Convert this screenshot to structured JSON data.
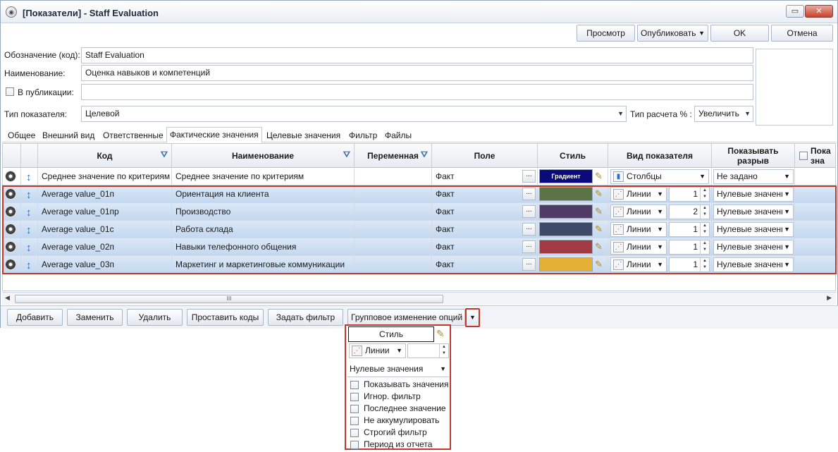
{
  "window": {
    "title": "[Показатели] - Staff Evaluation",
    "restore_glyph": "▭",
    "close_glyph": "✕"
  },
  "toolbar": {
    "preview": "Просмотр",
    "publish": "Опубликовать",
    "ok": "OK",
    "cancel": "Отмена"
  },
  "form": {
    "code_label": "Обозначение (код):",
    "code_value": "Staff Evaluation",
    "name_label": "Наименование:",
    "name_value": "Оценка навыков и компетенций",
    "publication_label": "В публикации:",
    "publication_value": "",
    "type_label": "Тип показателя:",
    "type_value": "Целевой",
    "calc_label": "Тип расчета % :",
    "calc_value": "Увеличить"
  },
  "tabs": [
    "Общее",
    "Внешний вид",
    "Ответственные",
    "Фактические значения",
    "Целевые значения",
    "Фильтр",
    "Файлы"
  ],
  "grid": {
    "headers": {
      "code": "Код",
      "name": "Наименование",
      "variable": "Переменная",
      "field": "Поле",
      "style": "Стиль",
      "view": "Вид показателя",
      "gap": "Показывать разрыв",
      "last": "Пока\nзна"
    },
    "first_row": {
      "code": "Среднее значение по критериям",
      "name": "Среднее значение по критериям",
      "field": "Факт",
      "style_label": "Градиент",
      "view": "Столбцы",
      "gap": "Не задано"
    },
    "rows": [
      {
        "code": "Average value_01п",
        "name": "Ориентация на клиента",
        "field": "Факт",
        "color": "#5b7347",
        "view": "Линии",
        "num": "1",
        "gap": "Нулевые значения"
      },
      {
        "code": "Average value_01пр",
        "name": "Производство",
        "field": "Факт",
        "color": "#4f3b66",
        "view": "Линии",
        "num": "2",
        "gap": "Нулевые значения"
      },
      {
        "code": "Average value_01с",
        "name": "Работа склада",
        "field": "Факт",
        "color": "#3e4b68",
        "view": "Линии",
        "num": "1",
        "gap": "Нулевые значения"
      },
      {
        "code": "Average value_02п",
        "name": "Навыки телефонного общения",
        "field": "Факт",
        "color": "#a23a44",
        "view": "Линии",
        "num": "1",
        "gap": "Нулевые значения"
      },
      {
        "code": "Average value_03п",
        "name": "Маркетинг и маркетинговые коммуникации",
        "field": "Факт",
        "color": "#e3b033",
        "view": "Линии",
        "num": "1",
        "gap": "Нулевые значения"
      }
    ],
    "dots": "...",
    "scroll_thumb": "III"
  },
  "bottom": {
    "add": "Добавить",
    "replace": "Заменить",
    "delete": "Удалить",
    "set_codes": "Проставить коды",
    "set_filter": "Задать фильтр",
    "group_change": "Групповое изменение опций"
  },
  "popup": {
    "style": "Стиль",
    "view": "Линии",
    "gap": "Нулевые значения",
    "options": [
      "Показывать значения",
      "Игнор. фильтр",
      "Последнее значение",
      "Не аккумулировать",
      "Строгий фильтр",
      "Период из отчета"
    ]
  },
  "colors": {
    "accent_outline": "#c0392b",
    "selected_row": "#c9dbf1",
    "gradient_swatch": "#0a0a7a"
  },
  "icons": [
    "app-icon",
    "restore-icon",
    "close-icon",
    "filter-icon",
    "gear-icon",
    "sort-icon",
    "style-picker-icon",
    "lines-chart-icon",
    "bars-chart-icon",
    "chevron-down-icon",
    "checkbox-icon"
  ]
}
